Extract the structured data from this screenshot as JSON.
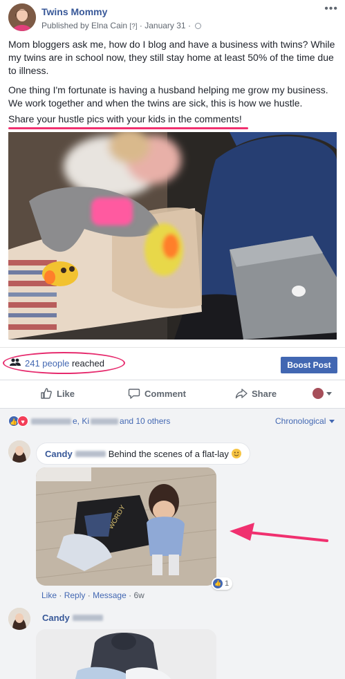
{
  "post": {
    "page_name": "Twins Mommy",
    "published_by": "Published by Elna Cain",
    "help": "[?]",
    "date": "January 31",
    "separator": "·",
    "more": "•••",
    "paragraph1": "Mom bloggers ask me, how do I blog and have a business with twins? While my twins are in school now, they still stay home at least 50% of the time due to illness.",
    "paragraph2": "One thing I'm fortunate is having a husband helping me grow my business. We work together and when the twins are sick, this is how we hustle.",
    "paragraph3": "Share your hustle pics with your kids in the comments!"
  },
  "reach": {
    "count_link": "241 people",
    "suffix": " reached",
    "boost_label": "Boost Post"
  },
  "actions": {
    "like": "Like",
    "comment": "Comment",
    "share": "Share"
  },
  "reactions": {
    "names_suffix": "e, Ki",
    "names_tail": "and 10 others",
    "sort": "Chronological"
  },
  "comments": [
    {
      "name": "Candy",
      "text": "Behind the scenes of a flat-lay",
      "image_reaction_count": "1",
      "links": {
        "like": "Like",
        "reply": "Reply",
        "message": "Message",
        "age": "6w"
      }
    },
    {
      "name": "Candy"
    }
  ],
  "image_text": "WORDY",
  "colors": {
    "brand_blue": "#4267b2",
    "link_blue": "#385898",
    "highlight_pink": "#e62a6d",
    "comment_bg": "#f2f3f5"
  }
}
